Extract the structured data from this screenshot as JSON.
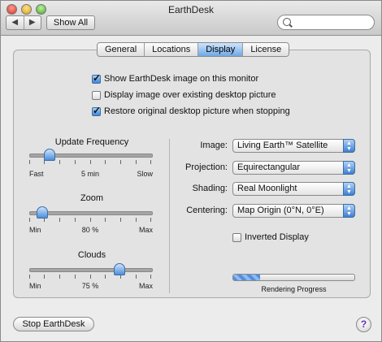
{
  "window": {
    "title": "EarthDesk"
  },
  "toolbar": {
    "back_glyph": "◀",
    "forward_glyph": "▶",
    "show_all_label": "Show All",
    "search": {
      "value": "",
      "placeholder": ""
    }
  },
  "tabs": [
    {
      "label": "General",
      "active": false
    },
    {
      "label": "Locations",
      "active": false
    },
    {
      "label": "Display",
      "active": true
    },
    {
      "label": "License",
      "active": false
    }
  ],
  "checkboxes": [
    {
      "label": "Show EarthDesk image on this monitor",
      "checked": true
    },
    {
      "label": "Display image over existing desktop picture",
      "checked": false
    },
    {
      "label": "Restore original desktop picture when stopping",
      "checked": true
    }
  ],
  "sliders": [
    {
      "label": "Update Frequency",
      "min": "Fast",
      "mid": "5 min",
      "max": "Slow",
      "value": 0.16
    },
    {
      "label": "Zoom",
      "min": "Min",
      "mid": "80 %",
      "max": "Max",
      "value": 0.1
    },
    {
      "label": "Clouds",
      "min": "Min",
      "mid": "75 %",
      "max": "Max",
      "value": 0.75
    }
  ],
  "popups": [
    {
      "label": "Image:",
      "value": "Living Earth™ Satellite"
    },
    {
      "label": "Projection:",
      "value": "Equirectangular"
    },
    {
      "label": "Shading:",
      "value": "Real Moonlight"
    },
    {
      "label": "Centering:",
      "value": "Map Origin (0°N, 0°E)"
    }
  ],
  "inverted_display": {
    "label": "Inverted Display",
    "checked": false
  },
  "rendering": {
    "label": "Rendering Progress",
    "progress": 0.22
  },
  "footer": {
    "stop_label": "Stop EarthDesk",
    "help_glyph": "?"
  },
  "colors": {
    "accent": "#3f86d8",
    "help": "#6a2fb1"
  },
  "icons": {
    "search": "magnifier-icon",
    "help": "help-icon"
  }
}
